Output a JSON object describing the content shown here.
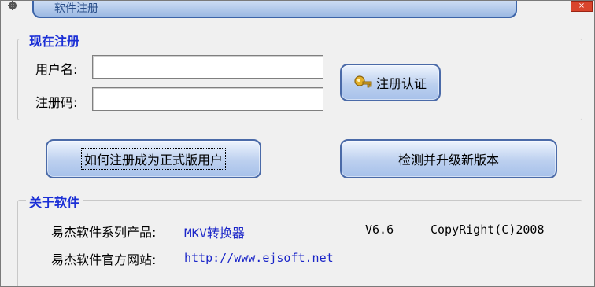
{
  "window": {
    "title": "软件注册",
    "close_label": "×"
  },
  "register_group": {
    "title": "现在注册",
    "username_label": "用户名:",
    "username_value": "",
    "code_label": "注册码:",
    "code_value": "",
    "verify_button": "注册认证",
    "verify_icon": "key-icon"
  },
  "actions": {
    "how_to_register": "如何注册成为正式版用户",
    "check_update": "检测并升级新版本"
  },
  "about_group": {
    "title": "关于软件",
    "product_label": "易杰软件系列产品:",
    "product_name": "MKV转换器",
    "version": "V6.6",
    "copyright": "CopyRight(C)2008",
    "website_label": "易杰软件官方网站:",
    "website_url": "http://www.ejsoft.net"
  },
  "colors": {
    "group_title": "#1b2fd6",
    "link": "#1a25c8",
    "button_border": "#4a6aa8",
    "background": "#f0f0f0"
  }
}
